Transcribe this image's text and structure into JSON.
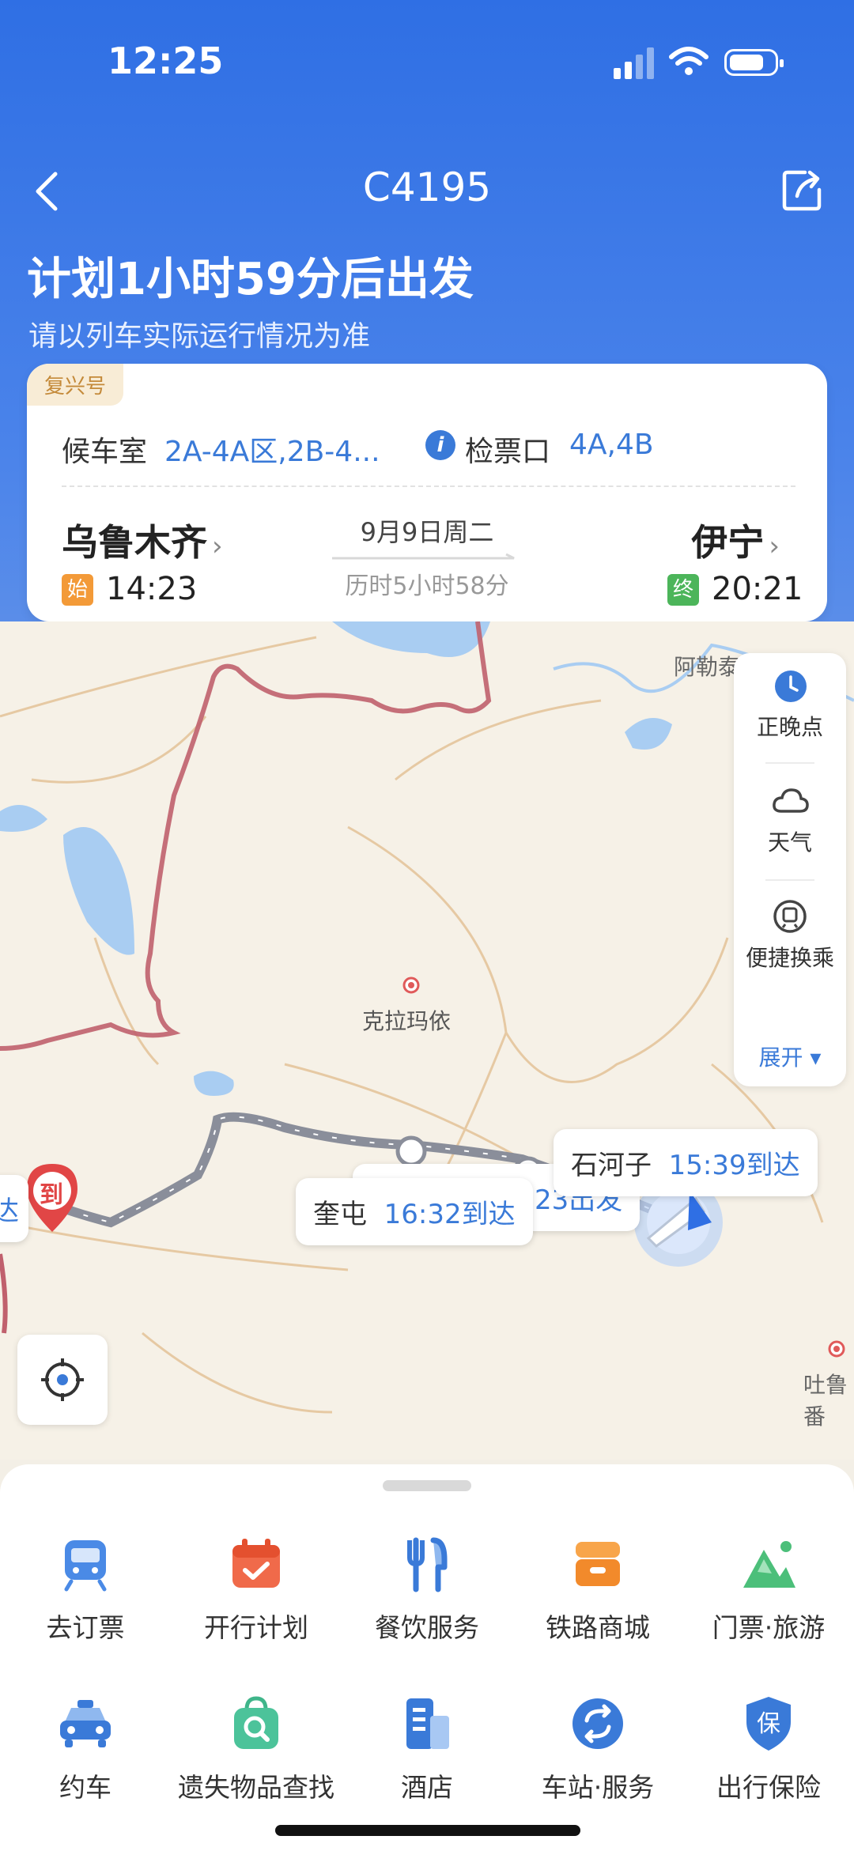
{
  "status_bar": {
    "time": "12:25"
  },
  "nav": {
    "title": "C4195"
  },
  "header": {
    "headline": "计划1小时59分后出发",
    "note": "请以列车实际运行情况为准"
  },
  "card": {
    "badge": "复兴号",
    "waiting_room_label": "候车室",
    "waiting_room_value": "2A-4A区,2B-4...",
    "gate_label": "检票口",
    "gate_value": "4A,4B",
    "from_station": "乌鲁木齐",
    "to_station": "伊宁",
    "date": "9月9日周二",
    "duration": "历时5小时58分",
    "start_tag": "始",
    "start_time": "14:23",
    "end_tag": "终",
    "end_time": "20:21"
  },
  "map": {
    "place_labels": [
      "阿勒泰地区",
      "克拉玛依",
      "吐鲁番"
    ],
    "arrival_marker": "到",
    "stations": [
      {
        "name": "石河子",
        "status": "15:39到达"
      },
      {
        "name": "奎屯",
        "status": "16:32到达"
      }
    ],
    "partial_departure": "23出发",
    "partial_left": "达"
  },
  "side_panel": {
    "items": [
      "正晚点",
      "天气",
      "便捷换乘"
    ],
    "expand_label": "展开"
  },
  "services": [
    {
      "label": "去订票",
      "icon": "train-icon"
    },
    {
      "label": "开行计划",
      "icon": "calendar-icon"
    },
    {
      "label": "餐饮服务",
      "icon": "dining-icon"
    },
    {
      "label": "铁路商城",
      "icon": "shop-icon"
    },
    {
      "label": "门票·旅游",
      "icon": "mountain-icon"
    },
    {
      "label": "约车",
      "icon": "taxi-icon"
    },
    {
      "label": "遗失物品查找",
      "icon": "lost-found-icon"
    },
    {
      "label": "酒店",
      "icon": "hotel-icon"
    },
    {
      "label": "车站·服务",
      "icon": "station-service-icon"
    },
    {
      "label": "出行保险",
      "icon": "insurance-icon"
    }
  ],
  "colors": {
    "header_blue": "#2f6fe4",
    "accent_blue": "#3a7ad8",
    "start_orange": "#f39a38",
    "end_green": "#4cb55a"
  }
}
